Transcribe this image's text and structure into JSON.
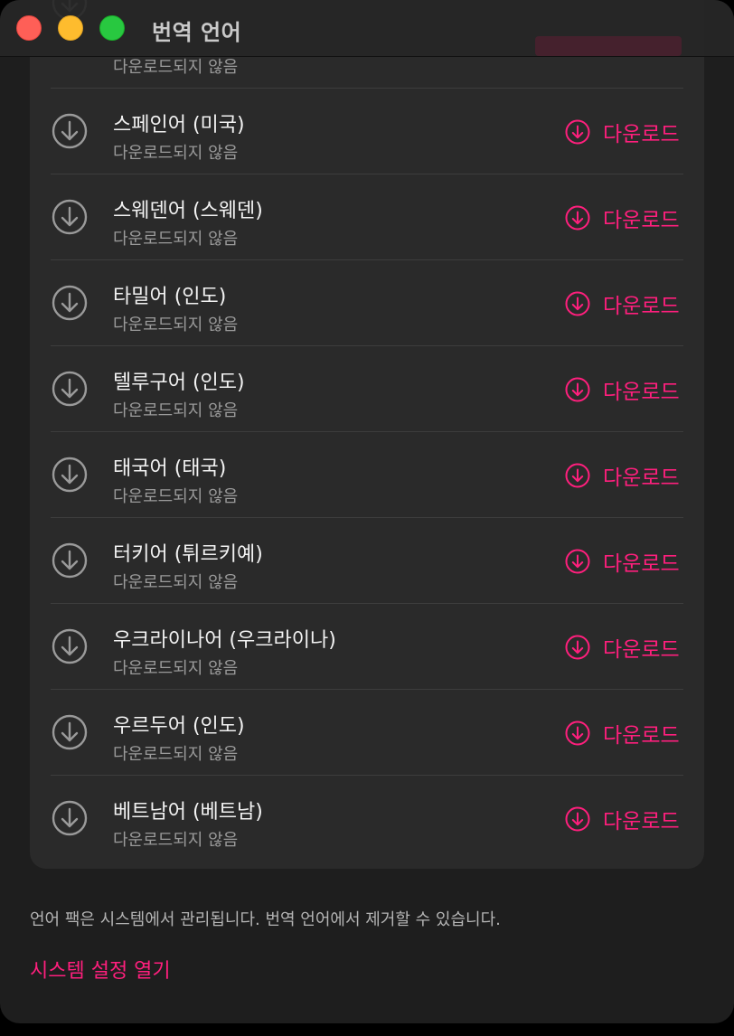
{
  "window": {
    "title": "번역 언어"
  },
  "colors": {
    "accent": "#ff1f7d",
    "background": "#1e1e1e",
    "card": "#2a2a2a"
  },
  "languages": {
    "partial_status": "다운로드되지 않음",
    "items": [
      {
        "name": "스페인어 (미국)",
        "status": "다운로드되지 않음",
        "action": "다운로드"
      },
      {
        "name": "스웨덴어 (스웨덴)",
        "status": "다운로드되지 않음",
        "action": "다운로드"
      },
      {
        "name": "타밀어 (인도)",
        "status": "다운로드되지 않음",
        "action": "다운로드"
      },
      {
        "name": "텔루구어 (인도)",
        "status": "다운로드되지 않음",
        "action": "다운로드"
      },
      {
        "name": "태국어 (태국)",
        "status": "다운로드되지 않음",
        "action": "다운로드"
      },
      {
        "name": "터키어 (튀르키예)",
        "status": "다운로드되지 않음",
        "action": "다운로드"
      },
      {
        "name": "우크라이나어 (우크라이나)",
        "status": "다운로드되지 않음",
        "action": "다운로드"
      },
      {
        "name": "우르두어 (인도)",
        "status": "다운로드되지 않음",
        "action": "다운로드"
      },
      {
        "name": "베트남어 (베트남)",
        "status": "다운로드되지 않음",
        "action": "다운로드"
      }
    ]
  },
  "footer": {
    "note": "언어 팩은 시스템에서 관리됩니다. 번역 언어에서 제거할 수 있습니다.",
    "link": "시스템 설정 열기"
  }
}
